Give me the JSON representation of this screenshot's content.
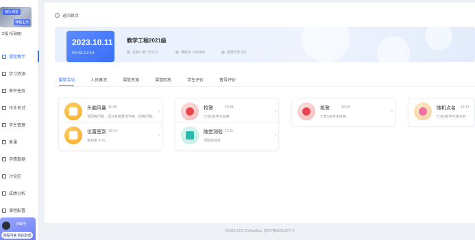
{
  "sidebar": {
    "cover_tag": "随行课堂",
    "cover_sub": "课程主页",
    "course_name": "工程 (行政班)",
    "items": [
      {
        "label": "课堂教学",
        "active": true
      },
      {
        "label": "学习资源",
        "active": false
      },
      {
        "label": "章节任务",
        "active": false
      },
      {
        "label": "作业考试",
        "active": false
      },
      {
        "label": "学生管理",
        "active": false
      },
      {
        "label": "备课",
        "active": false
      },
      {
        "label": "学情数据",
        "active": false
      },
      {
        "label": "讨论区",
        "active": false
      },
      {
        "label": "成绩分析",
        "active": false
      },
      {
        "label": "课程配置",
        "active": false
      }
    ],
    "bottom_card": {
      "label": "AI助手",
      "button": "课程问答 我的助理"
    }
  },
  "main": {
    "back_label": "返回首页",
    "banner": {
      "date": "2023.10.11",
      "time": "09:43-12:43",
      "class_title": "教学工程2021级",
      "stats": [
        "实到人数 75/76人",
        "课时长 180分钟",
        "授课节次 6次"
      ]
    },
    "tabs": [
      {
        "label": "课堂活动",
        "active": true
      },
      {
        "label": "人员概况",
        "active": false
      },
      {
        "label": "课堂资源",
        "active": false
      },
      {
        "label": "课堂回放",
        "active": false
      },
      {
        "label": "学生评价",
        "active": false
      },
      {
        "label": "督导评价",
        "active": false
      }
    ],
    "cards": [
      {
        "title": "头脑风暴",
        "time": "11:48",
        "desc": "请回答问题，请注意按要求作答，回答问题..."
      },
      {
        "title": "抢答",
        "time": "10:48",
        "desc": "已有5名学生抢答"
      },
      {
        "title": "抢答",
        "time": "10:24",
        "desc": "已有5名学生抢答"
      },
      {
        "title": "随机点名",
        "time": "12:17",
        "desc": "已有3名学生被点名"
      },
      {
        "title": "位置签到",
        "time": "10:14",
        "desc": "签到率 97%"
      },
      {
        "title": "随堂测验",
        "time": "10:11",
        "desc": "测验完成率"
      }
    ]
  },
  "footer": "©2003-2023 ZhiXueBao. 京ICP备00013377-5",
  "icons": [
    "back-icon",
    "brain-icon",
    "alarm-icon",
    "location-icon",
    "quiz-icon",
    "roll-call-icon",
    "chevron-right-icon"
  ],
  "colors": {
    "accent": "#3a6ff7",
    "banner": "#e8f0fd"
  }
}
